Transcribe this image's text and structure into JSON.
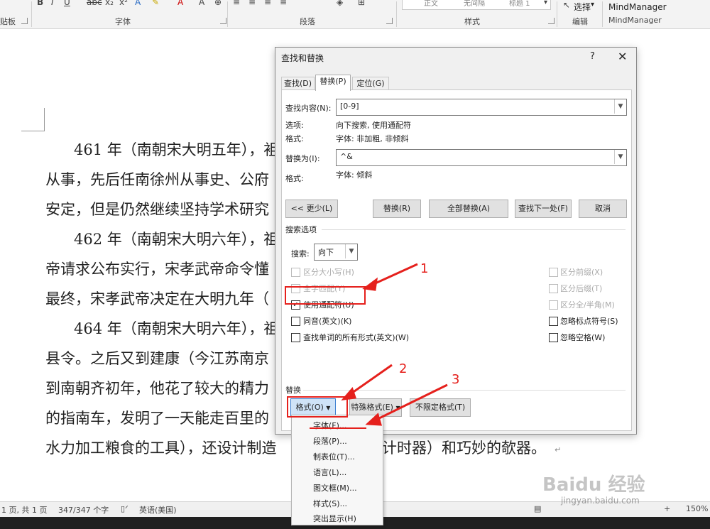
{
  "ribbon": {
    "groups": {
      "clipboard": "贴板",
      "font": "字体",
      "paragraph": "段落",
      "styles": "样式",
      "editing": "编辑",
      "mindmanager": "MindManager"
    },
    "style_items": [
      "正文",
      "无间隔",
      "标题 1"
    ],
    "select_label": "选择",
    "mindmanager_label": "MindManager"
  },
  "document": {
    "lines": [
      "461 年（南朝宋大明五年），袓",
      "从事，先后任南徐州从事史、公府",
      "安定，但是仍然继续坚持学术研究",
      "462 年（南朝宋大明六年），祖",
      "帝请求公布实行，宋孝武帝命令懂",
      "最终，宋孝武帝决定在大明九年（",
      "464 年（南朝宋大明六年），祖",
      "县令。之后又到建康（今江苏南京",
      "到南朝齐初年，他花了较大的精力",
      "的指南车，发明了一天能走百里的",
      "水力加工粮食的工具），还设计制造",
      "计时器）和巧妙的欹器。"
    ]
  },
  "dialog": {
    "title": "查找和替换",
    "help": "?",
    "close": "✕",
    "tabs": [
      "查找(D)",
      "替换(P)",
      "定位(G)"
    ],
    "find_label": "查找内容(N):",
    "find_value": "[0-9]",
    "options_label": "选项:",
    "options_value": "向下搜索, 使用通配符",
    "find_format_label": "格式:",
    "find_format_value": "字体: 非加粗, 非倾斜",
    "replace_label": "替换为(I):",
    "replace_value": "^&",
    "replace_format_label": "格式:",
    "replace_format_value": "字体: 倾斜",
    "buttons": {
      "less": "<< 更少(L)",
      "replace": "替换(R)",
      "replace_all": "全部替换(A)",
      "find_next": "查找下一处(F)",
      "cancel": "取消"
    },
    "search_options_title": "搜索选项",
    "search_label": "搜索:",
    "search_value": "向下",
    "checkboxes_left": [
      {
        "label": "区分大小写(H)",
        "checked": false,
        "disabled": true
      },
      {
        "label": "全字匹配(Y)",
        "checked": false,
        "disabled": true
      },
      {
        "label": "使用通配符(U)",
        "checked": true,
        "disabled": false
      },
      {
        "label": "同音(英文)(K)",
        "checked": false,
        "disabled": false
      },
      {
        "label": "查找单词的所有形式(英文)(W)",
        "checked": false,
        "disabled": false
      }
    ],
    "checkboxes_right": [
      {
        "label": "区分前缀(X)",
        "checked": false,
        "disabled": true
      },
      {
        "label": "区分后缀(T)",
        "checked": false,
        "disabled": true
      },
      {
        "label": "区分全/半角(M)",
        "checked": false,
        "disabled": true
      },
      {
        "label": "忽略标点符号(S)",
        "checked": false,
        "disabled": false
      },
      {
        "label": "忽略空格(W)",
        "checked": false,
        "disabled": false
      }
    ],
    "replace_section_title": "替换",
    "format_button": "格式(O)",
    "special_button": "特殊格式(E)",
    "no_format_button": "不限定格式(T)"
  },
  "format_menu": {
    "items": [
      "字体(F)...",
      "段落(P)...",
      "制表位(T)...",
      "语言(L)...",
      "图文框(M)...",
      "样式(S)...",
      "突出显示(H)"
    ]
  },
  "annotations": {
    "callouts": [
      "1",
      "2",
      "3"
    ],
    "color": "#e5201c"
  },
  "statusbar": {
    "page": "1 页, 共 1 页",
    "words": "347/347 个字",
    "language": "英语(美国)",
    "zoom": "150%"
  },
  "watermark": {
    "brand": "Baidu 经验",
    "url": "jingyan.baidu.com"
  }
}
